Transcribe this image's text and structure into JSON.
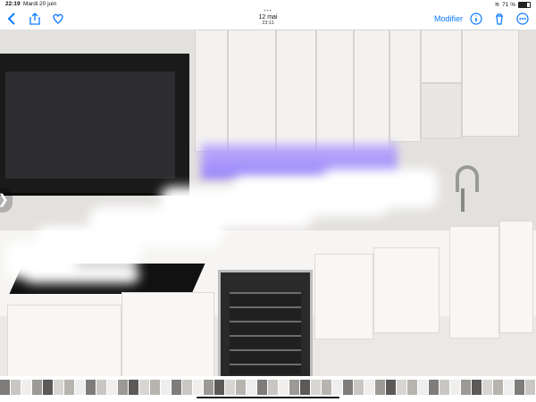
{
  "status_bar": {
    "time": "22:19",
    "date": "Mardi 20 juin",
    "battery_percent": "71 %",
    "battery_level": 0.71
  },
  "toolbar": {
    "date": "12 mai",
    "time": "23:11",
    "edit_label": "Modifier"
  },
  "icons": {
    "back": "chevron-left-icon",
    "share": "share-icon",
    "favorite": "heart-icon",
    "info": "info-icon",
    "delete": "trash-icon",
    "more": "more-icon"
  },
  "thumbnail_count": 50,
  "colors": {
    "accent": "#0a7aff"
  }
}
